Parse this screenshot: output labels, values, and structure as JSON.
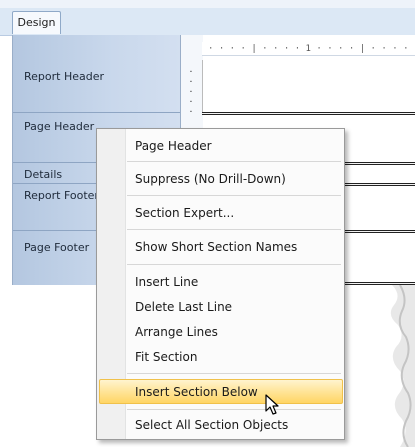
{
  "tabs": [
    {
      "label": "Design"
    }
  ],
  "ruler": {
    "text": "· · · · | · · · · 1 · · · · | · · · ·"
  },
  "sections": [
    {
      "label": "Report Header"
    },
    {
      "label": "Page Header"
    },
    {
      "label": "Details"
    },
    {
      "label": "Report Footer"
    },
    {
      "label": "Page Footer"
    }
  ],
  "context_menu": {
    "items": [
      {
        "label": "Page Header"
      },
      {
        "label": "Suppress (No Drill-Down)"
      },
      {
        "label": "Section Expert..."
      },
      {
        "label": "Show Short Section Names"
      },
      {
        "label": "Insert Line"
      },
      {
        "label": "Delete Last Line"
      },
      {
        "label": "Arrange Lines"
      },
      {
        "label": "Fit Section"
      },
      {
        "label": "Insert Section Below",
        "highlighted": true
      },
      {
        "label": "Select All Section Objects"
      }
    ]
  },
  "colors": {
    "section_panel": "#b4c7e0",
    "menu_highlight": "#ffe393",
    "tab_bar": "#dce8f5"
  }
}
